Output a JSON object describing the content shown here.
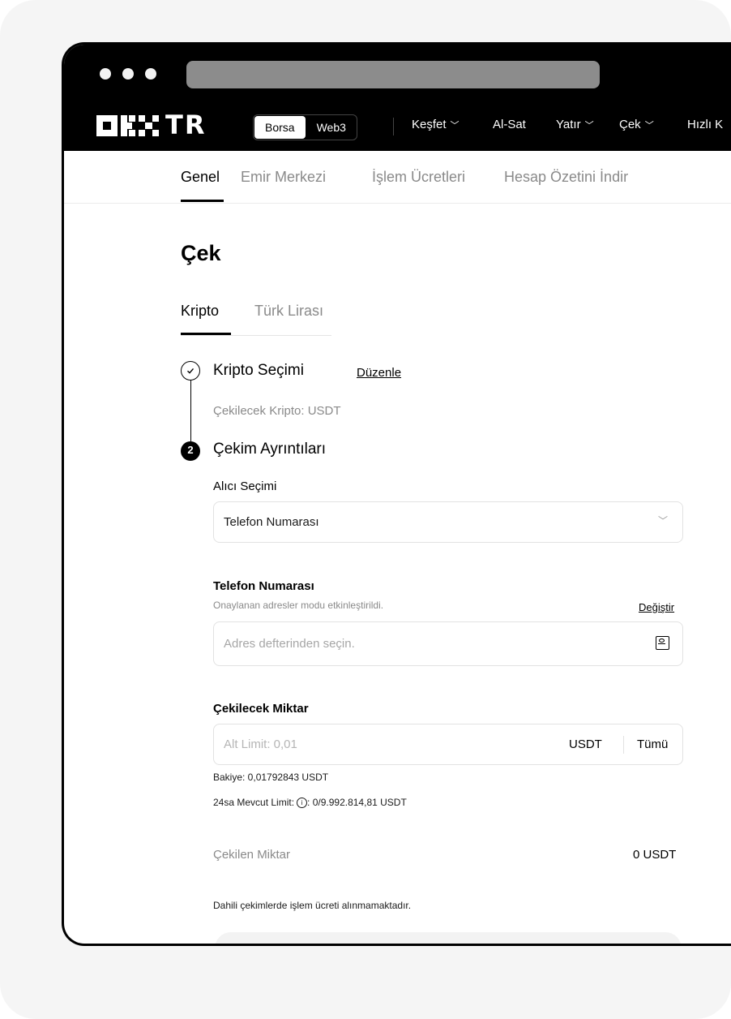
{
  "header": {
    "brand": "TR",
    "segment": [
      "Borsa",
      "Web3"
    ],
    "nav": [
      {
        "label": "Keşfet",
        "chevron": true
      },
      {
        "label": "Al-Sat",
        "chevron": false
      },
      {
        "label": "Yatır",
        "chevron": true
      },
      {
        "label": "Çek",
        "chevron": true
      },
      {
        "label": "Hızlı K",
        "chevron": false
      }
    ]
  },
  "subnav": [
    "Genel",
    "Emir Merkezi",
    "İşlem Ücretleri",
    "Hesap Özetini İndir"
  ],
  "page": {
    "title": "Çek",
    "tabs": [
      "Kripto",
      "Türk Lirası"
    ]
  },
  "step1": {
    "title": "Kripto Seçimi",
    "edit": "Düzenle",
    "detail": "Çekilecek Kripto: USDT"
  },
  "step2": {
    "number": "2",
    "title": "Çekim Ayrıntıları"
  },
  "recipient": {
    "label": "Alıcı Seçimi",
    "value": "Telefon Numarası"
  },
  "phone": {
    "label": "Telefon Numarası",
    "hint": "Onaylanan adresler modu etkinleştirildi.",
    "change": "Değiştir",
    "placeholder": "Adres defterinden seçin."
  },
  "amount": {
    "label": "Çekilecek Miktar",
    "placeholder": "Alt Limit: 0,01",
    "unit": "USDT",
    "all": "Tümü",
    "balance": "Bakiye: 0,01792843 USDT",
    "limit_prefix": "24sa Mevcut Limit:",
    "limit_value": ": 0/9.992.814,81 USDT"
  },
  "withdrawn": {
    "label": "Çekilen Miktar",
    "value": "0 USDT",
    "note": "Dahili çekimlerde işlem ücreti alınmamaktadır."
  }
}
